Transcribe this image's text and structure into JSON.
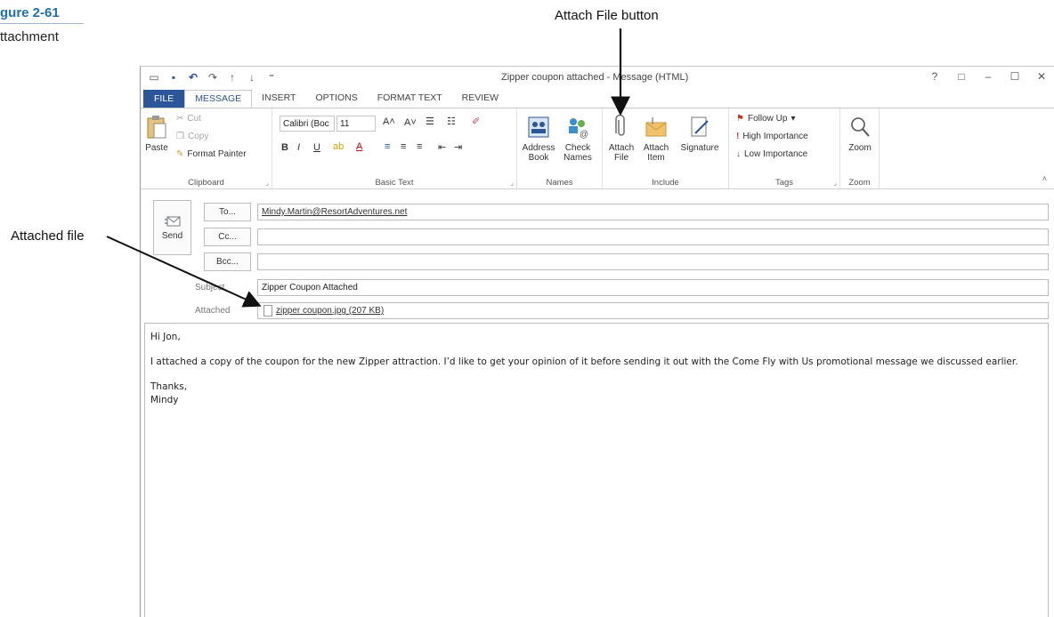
{
  "figure": {
    "number": "gure 2-61",
    "caption": "ttachment"
  },
  "callouts": {
    "attach_file": "Attach File button",
    "attached_file": "Attached file"
  },
  "window": {
    "title": "Zipper coupon attached - Message (HTML)",
    "controls": [
      "?",
      "□",
      "–",
      "☐",
      "✕"
    ]
  },
  "tabs": [
    "FILE",
    "MESSAGE",
    "INSERT",
    "OPTIONS",
    "FORMAT TEXT",
    "REVIEW"
  ],
  "ribbon": {
    "clipboard": {
      "paste": "Paste",
      "cut": "Cut",
      "copy": "Copy",
      "format_painter": "Format Painter",
      "label": "Clipboard"
    },
    "basic_text": {
      "font_name": "Calibri (Boc",
      "font_size": "11",
      "label": "Basic Text"
    },
    "names": {
      "address_book": "Address Book",
      "check_names": "Check Names",
      "label": "Names"
    },
    "include": {
      "attach_file": "Attach File",
      "attach_item": "Attach Item",
      "signature": "Signature",
      "label": "Include"
    },
    "tags": {
      "follow_up": "Follow Up",
      "high_importance": "High Importance",
      "low_importance": "Low Importance",
      "label": "Tags"
    },
    "zoom": {
      "zoom": "Zoom",
      "label": "Zoom"
    }
  },
  "header": {
    "send": "Send",
    "to_label": "To...",
    "cc_label": "Cc...",
    "bcc_label": "Bcc...",
    "subject_label": "Subject",
    "attached_label": "Attached",
    "to_value": "Mindy.Martin@ResortAdventures.net",
    "cc_value": "",
    "bcc_value": "",
    "subject_value": "Zipper Coupon Attached",
    "attachment": "zipper coupon.jpg (207 KB)"
  },
  "body": {
    "greeting": "Hi Jon,",
    "paragraph": "I attached a copy of the coupon for the new Zipper attraction. I’d like to get your opinion of it before sending it out with the Come Fly with Us promotional message we discussed earlier.",
    "closing": "Thanks,",
    "signature": "Mindy"
  }
}
